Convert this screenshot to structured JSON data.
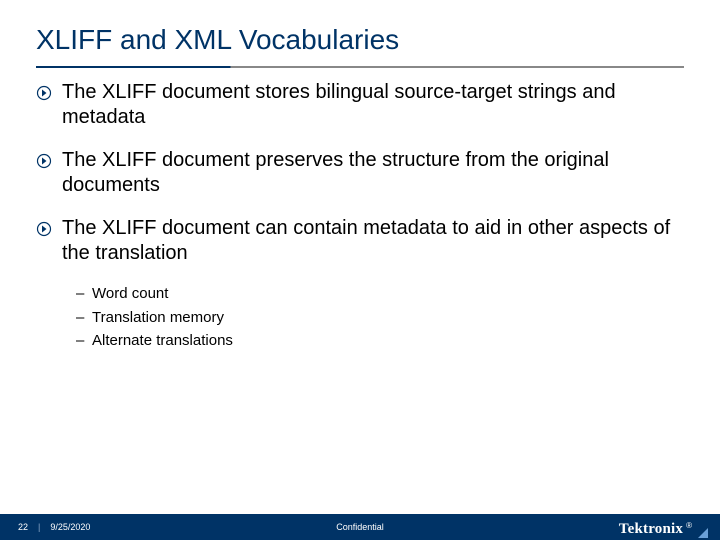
{
  "title": "XLIFF and XML Vocabularies",
  "bullets": [
    {
      "text": "The XLIFF document stores bilingual source-target strings and metadata"
    },
    {
      "text": "The XLIFF document preserves the structure from the original documents"
    },
    {
      "text": "The XLIFF document can contain metadata to aid in other aspects of the translation"
    }
  ],
  "subitems": [
    {
      "text": "Word count"
    },
    {
      "text": "Translation memory"
    },
    {
      "text": "Alternate translations"
    }
  ],
  "footer": {
    "page": "22",
    "date": "9/25/2020",
    "confidential": "Confidential",
    "logo": "Tektronix",
    "reg": "®"
  },
  "icon_name": "arrow-circle-right-icon"
}
